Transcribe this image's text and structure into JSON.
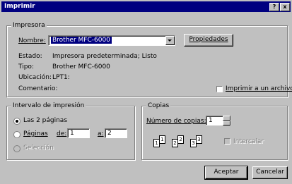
{
  "window": {
    "title": "Imprimir",
    "help_label": "?",
    "close_label": "x"
  },
  "printer": {
    "group_label": "Impresora",
    "name_label": "Nombre:",
    "name_value": "Brother MFC-6000",
    "properties_button": "Propiedades",
    "status_label": "Estado:",
    "status_value": "Impresora predeterminada; Listo",
    "type_label": "Tipo:",
    "type_value": "Brother MFC-6000",
    "location_label": "Ubicación:",
    "location_value": "LPT1:",
    "comment_label": "Comentario:",
    "print_to_file_label": "Imprimir a un archivo"
  },
  "range": {
    "group_label": "Intervalo de impresión",
    "all_label": "Las 2 páginas",
    "pages_label": "Páginas",
    "from_label": "de:",
    "from_value": "1",
    "to_label": "a:",
    "to_value": "2",
    "selection_label": "Selección"
  },
  "copies": {
    "group_label": "Copias",
    "count_label": "Número de copias:",
    "count_value": "1",
    "collate_label": "Intercalar",
    "pages": [
      "1",
      "1",
      "2",
      "2",
      "3",
      "3"
    ]
  },
  "footer": {
    "ok_button": "Aceptar",
    "cancel_button": "Cancelar"
  },
  "colors": {
    "titlebar": "#000080",
    "face": "#c0c0c0"
  },
  "icons": [
    "help-icon",
    "close-icon",
    "dropdown-arrow-icon",
    "spin-up-icon",
    "spin-down-icon",
    "collate-pages-icon"
  ]
}
